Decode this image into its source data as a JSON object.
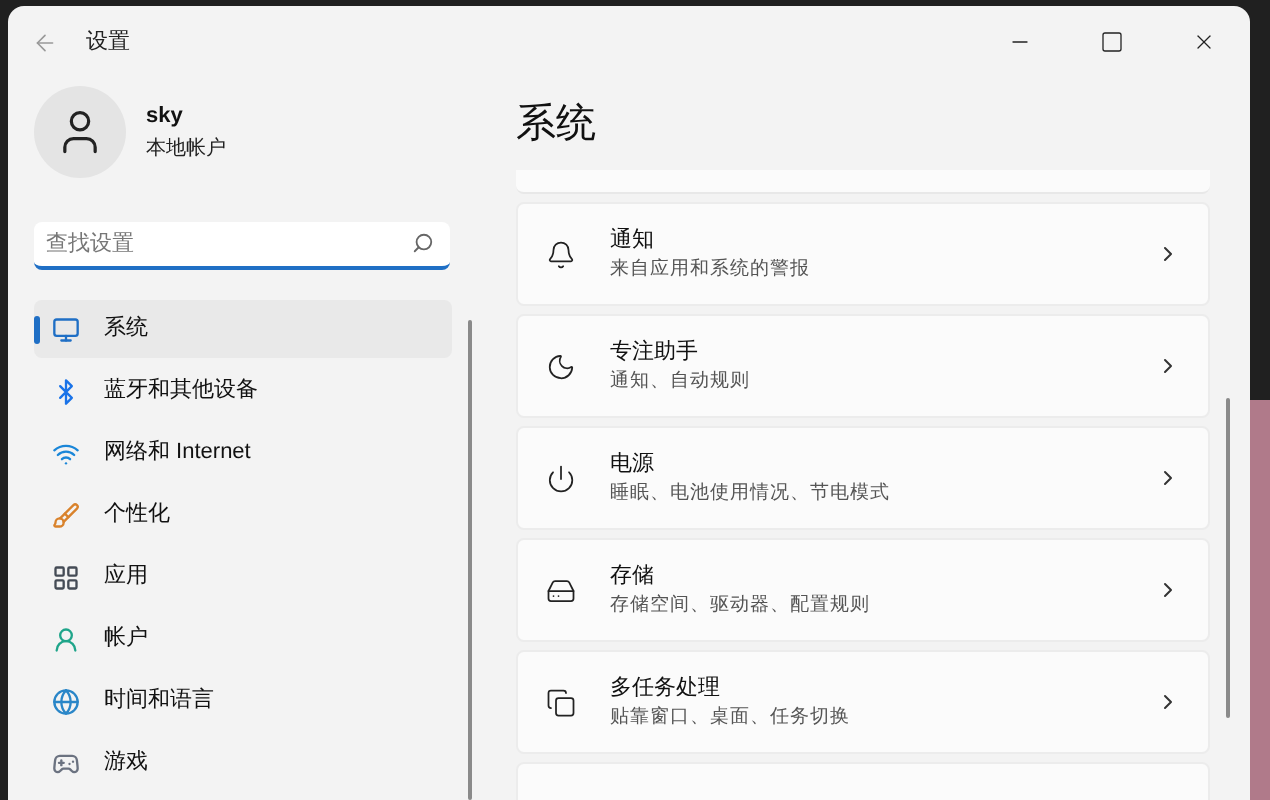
{
  "window": {
    "title": "设置"
  },
  "profile": {
    "name": "sky",
    "account_type": "本地帐户"
  },
  "search": {
    "placeholder": "查找设置"
  },
  "sidebar": {
    "items": [
      {
        "label": "系统",
        "selected": true
      },
      {
        "label": "蓝牙和其他设备",
        "selected": false
      },
      {
        "label": "网络和 Internet",
        "selected": false
      },
      {
        "label": "个性化",
        "selected": false
      },
      {
        "label": "应用",
        "selected": false
      },
      {
        "label": "帐户",
        "selected": false
      },
      {
        "label": "时间和语言",
        "selected": false
      },
      {
        "label": "游戏",
        "selected": false
      }
    ]
  },
  "page": {
    "title": "系统",
    "cards": [
      {
        "title": "通知",
        "subtitle": "来自应用和系统的警报"
      },
      {
        "title": "专注助手",
        "subtitle": "通知、自动规则"
      },
      {
        "title": "电源",
        "subtitle": "睡眠、电池使用情况、节电模式"
      },
      {
        "title": "存储",
        "subtitle": "存储空间、驱动器、配置规则"
      },
      {
        "title": "多任务处理",
        "subtitle": "贴靠窗口、桌面、任务切换"
      }
    ]
  }
}
